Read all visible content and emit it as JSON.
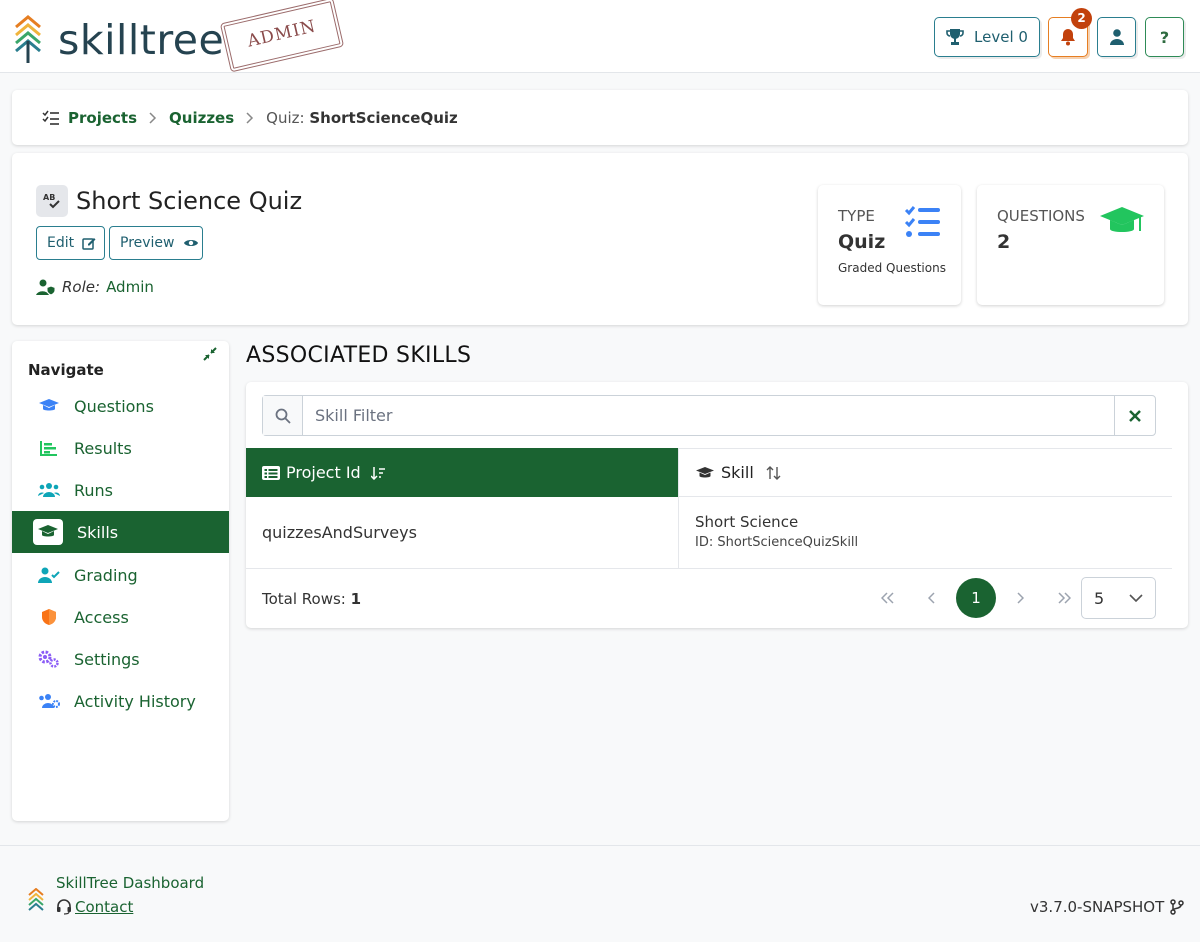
{
  "header": {
    "logo_text": "skilltree",
    "stamp": "ADMIN",
    "level_label": "Level 0",
    "notification_count": "2",
    "help_label": "?"
  },
  "breadcrumb": {
    "projects": "Projects",
    "quizzes": "Quizzes",
    "current_prefix": "Quiz:",
    "current_value": "ShortScienceQuiz"
  },
  "quiz": {
    "title": "Short Science Quiz",
    "edit_label": "Edit",
    "preview_label": "Preview",
    "role_label": "Role:",
    "role_value": "Admin"
  },
  "stats": {
    "type_label": "TYPE",
    "type_value": "Quiz",
    "type_sub": "Graded Questions",
    "questions_label": "QUESTIONS",
    "questions_value": "2"
  },
  "sidebar": {
    "title": "Navigate",
    "items": [
      {
        "label": "Questions",
        "icon": "graduation-cap-icon",
        "active": false
      },
      {
        "label": "Results",
        "icon": "chart-bar-icon",
        "active": false
      },
      {
        "label": "Runs",
        "icon": "users-icon",
        "active": false
      },
      {
        "label": "Skills",
        "icon": "graduation-cap-icon",
        "active": true
      },
      {
        "label": "Grading",
        "icon": "user-check-icon",
        "active": false
      },
      {
        "label": "Access",
        "icon": "shield-icon",
        "active": false
      },
      {
        "label": "Settings",
        "icon": "cogs-icon",
        "active": false
      },
      {
        "label": "Activity History",
        "icon": "users-cog-icon",
        "active": false
      }
    ]
  },
  "main": {
    "section_title": "ASSOCIATED SKILLS",
    "filter_placeholder": "Skill Filter",
    "columns": [
      "Project Id",
      "Skill"
    ],
    "rows": [
      {
        "project_id": "quizzesAndSurveys",
        "skill_name": "Short Science",
        "skill_id": "ID: ShortScienceQuizSkill"
      }
    ],
    "total_rows_label": "Total Rows:",
    "total_rows_value": "1",
    "current_page": "1",
    "per_page": "5"
  },
  "footer": {
    "title": "SkillTree Dashboard",
    "contact": "Contact",
    "version": "v3.7.0-SNAPSHOT"
  },
  "colors": {
    "primary_green": "#1a6331",
    "accent_teal": "#2a7e8f",
    "badge_red": "#c2410c",
    "stat_blue": "#3b82f6",
    "stat_green": "#22c55e"
  }
}
